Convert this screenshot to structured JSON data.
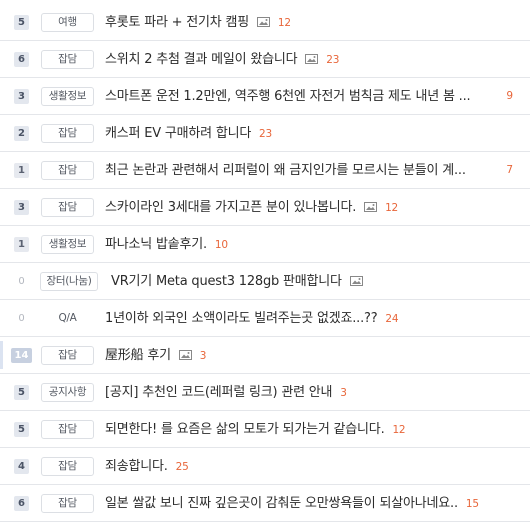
{
  "posts": [
    {
      "count": "5",
      "category": "여행",
      "title": "후롯토 파라 + 전기차 캠핑",
      "has_image": true,
      "comments": "12"
    },
    {
      "count": "6",
      "category": "잡담",
      "title": "스위치 2 추첨 결과 메일이 왔습니다",
      "has_image": true,
      "comments": "23"
    },
    {
      "count": "3",
      "category": "생활정보",
      "title": "스마트폰 운전 1.2만엔, 역주행 6천엔 자전거 범칙금 제도 내년 봄 ...",
      "has_image": false,
      "comments": "9"
    },
    {
      "count": "2",
      "category": "잡담",
      "title": "캐스퍼 EV 구매하려 합니다",
      "has_image": false,
      "comments": "23"
    },
    {
      "count": "1",
      "category": "잡담",
      "title": "최근 논란과 관련해서 리퍼럴이 왜 금지인가를 모르시는 분들이 계...",
      "has_image": false,
      "comments": "7"
    },
    {
      "count": "3",
      "category": "잡담",
      "title": "스카이라인 3세대를 가지고픈 분이 있나봅니다.",
      "has_image": true,
      "comments": "12"
    },
    {
      "count": "1",
      "category": "생활정보",
      "title": "파나소닉 밥솥후기.",
      "has_image": false,
      "comments": "10"
    },
    {
      "count": "0",
      "category": "장터(나눔)",
      "title": "VR기기 Meta quest3 128gb 판매합니다",
      "has_image": true,
      "comments": ""
    },
    {
      "count": "0",
      "category": "Q/A",
      "title": "1년이하 외국인 소액이라도 빌려주는곳 없겠죠...??",
      "has_image": false,
      "comments": "24"
    },
    {
      "count": "14",
      "category": "잡담",
      "title": "屋形船 후기",
      "has_image": true,
      "comments": "3"
    },
    {
      "count": "5",
      "category": "공지사항",
      "title": "[공지] 추천인 코드(레퍼럴 링크) 관련 안내",
      "has_image": false,
      "comments": "3"
    },
    {
      "count": "5",
      "category": "잡담",
      "title": "되면한다! 를 요즘은 삶의 모토가 되가는거 같습니다.",
      "has_image": false,
      "comments": "12"
    },
    {
      "count": "4",
      "category": "잡담",
      "title": "죄송합니다.",
      "has_image": false,
      "comments": "25"
    },
    {
      "count": "6",
      "category": "잡담",
      "title": "일본 쌀값 보니 진짜 깊은곳이 감춰둔 오만쌍욕들이 되살아나네요..",
      "has_image": false,
      "comments": "15"
    }
  ],
  "colors": {
    "comment": "#e8663a",
    "border": "#e4e6ea",
    "accent_bar": "#dbe3f1"
  },
  "icons": {
    "image_attachment": "image-icon"
  }
}
